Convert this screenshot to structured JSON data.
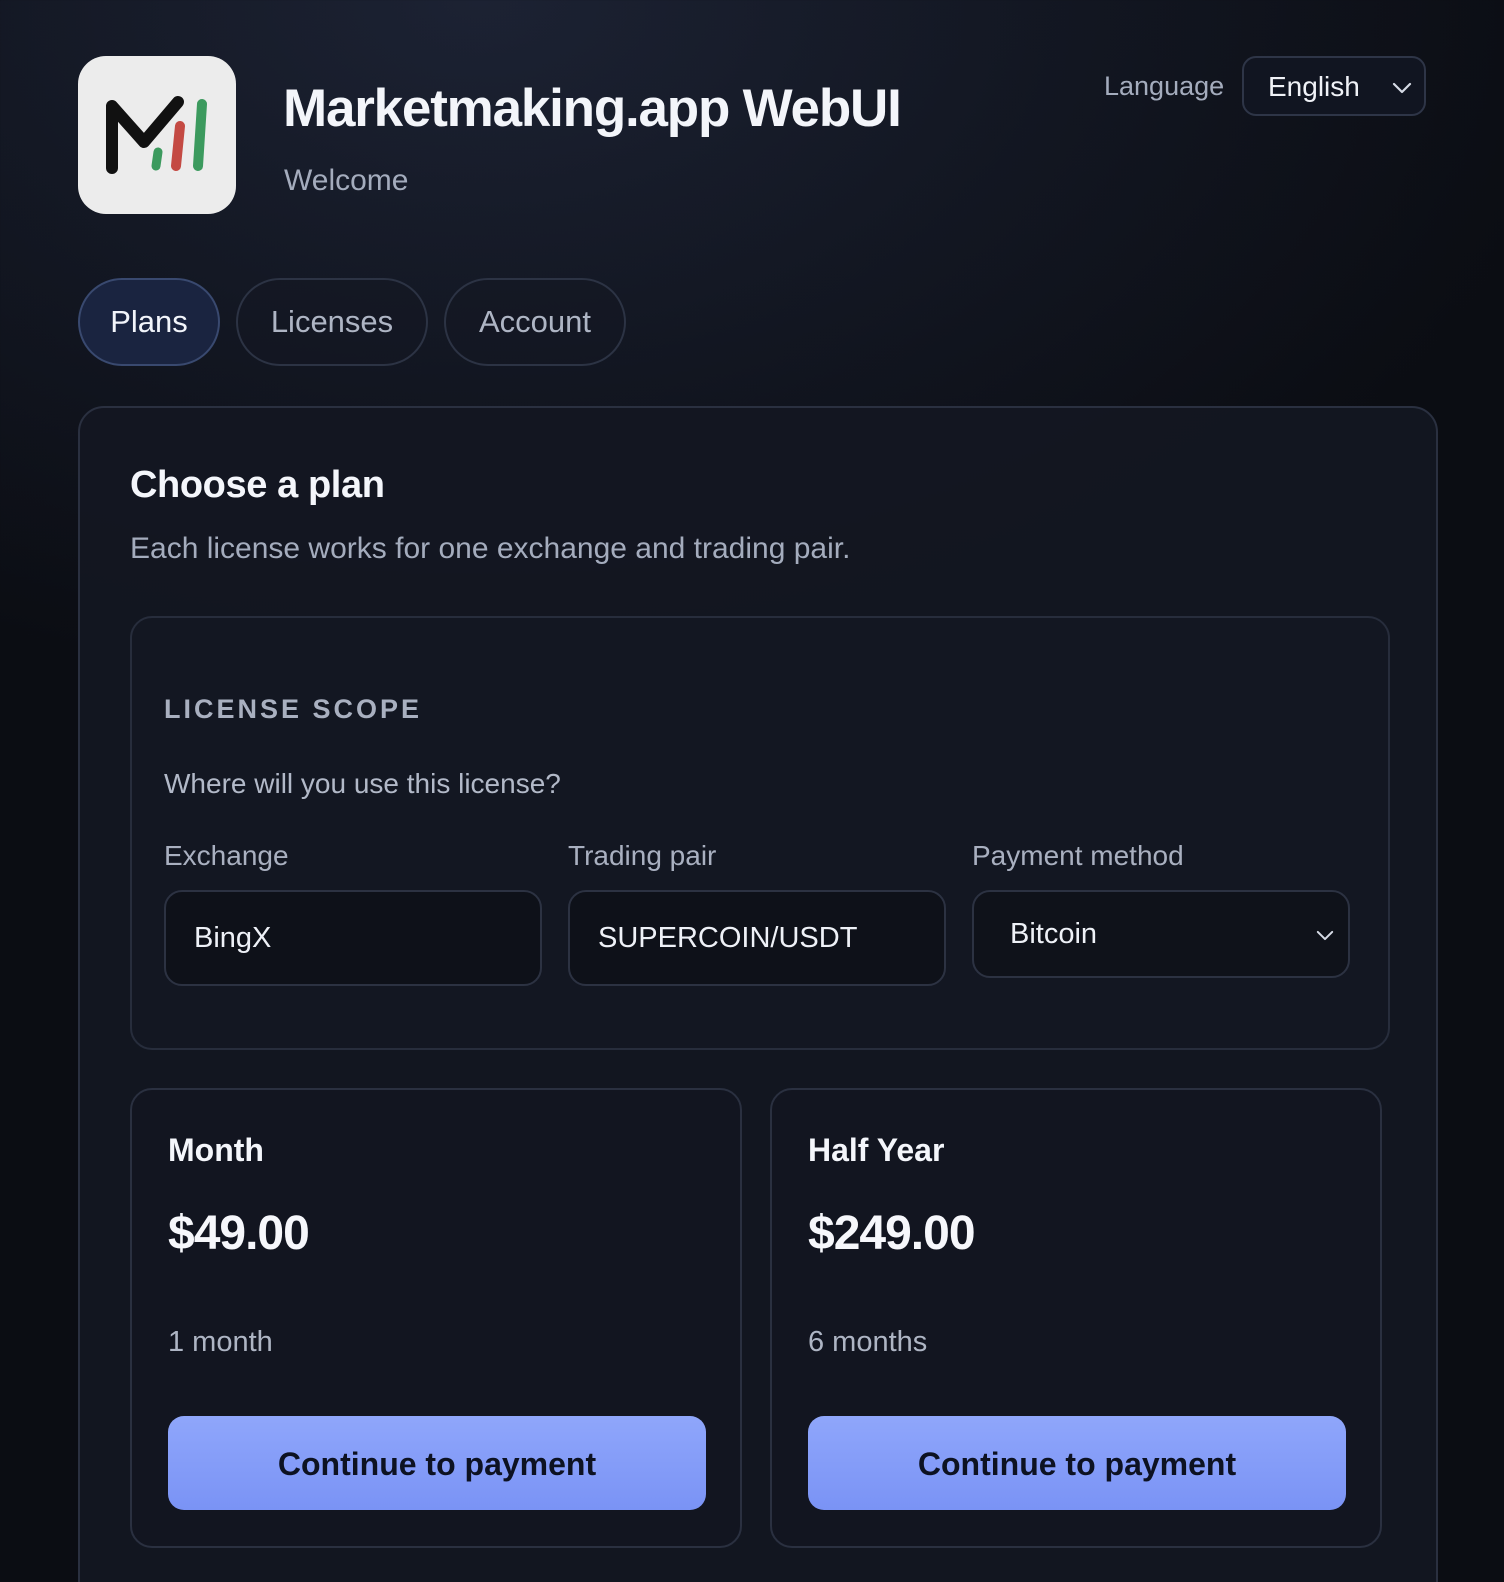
{
  "header": {
    "title": "Marketmaking.app WebUI",
    "subtitle": "Welcome",
    "language_label": "Language",
    "language_value": "English"
  },
  "tabs": [
    {
      "label": "Plans",
      "active": true
    },
    {
      "label": "Licenses",
      "active": false
    },
    {
      "label": "Account",
      "active": false
    }
  ],
  "main": {
    "title": "Choose a plan",
    "subtitle": "Each license works for one exchange and trading pair.",
    "scope": {
      "heading": "LICENSE SCOPE",
      "question": "Where will you use this license?",
      "exchange": {
        "label": "Exchange",
        "value": "BingX"
      },
      "pair": {
        "label": "Trading pair",
        "value": "SUPERCOIN/USDT"
      },
      "payment": {
        "label": "Payment method",
        "value": "Bitcoin"
      }
    },
    "plans": [
      {
        "name": "Month",
        "price": "$49.00",
        "duration": "1 month",
        "button": "Continue to payment"
      },
      {
        "name": "Half Year",
        "price": "$249.00",
        "duration": "6 months",
        "button": "Continue to payment"
      }
    ]
  },
  "colors": {
    "accent": "#8fa6fb",
    "logo_red": "#c44a43",
    "logo_green": "#3c9a5e",
    "background": "#121621"
  }
}
